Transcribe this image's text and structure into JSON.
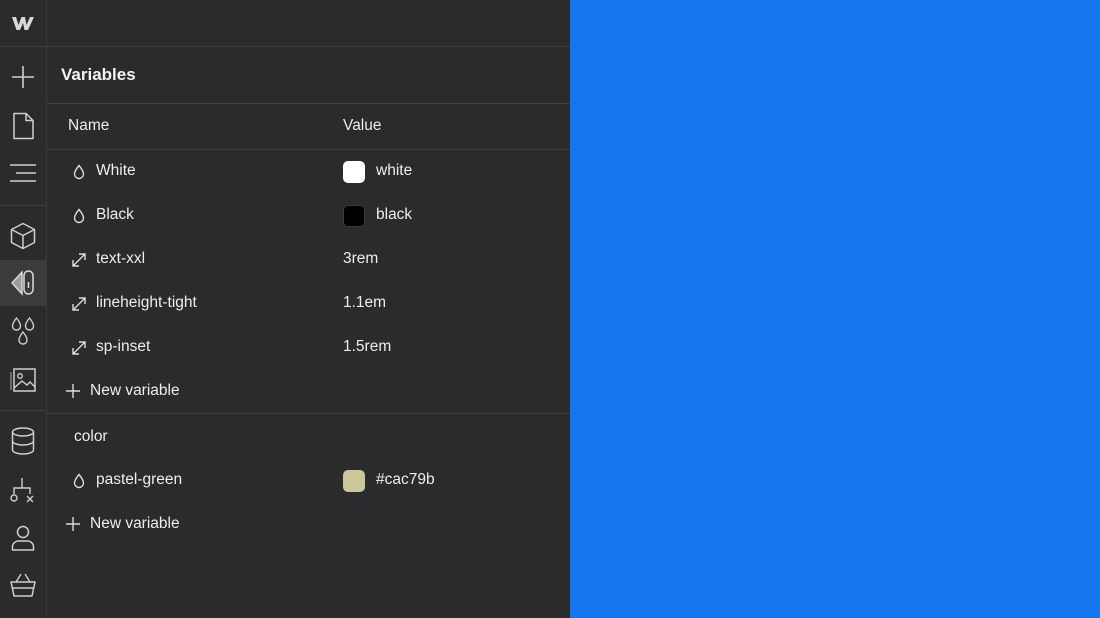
{
  "panel": {
    "title": "Variables",
    "columns": {
      "name": "Name",
      "value": "Value"
    },
    "variables": [
      {
        "icon": "droplet-icon",
        "name": "White",
        "value": "white",
        "swatch": "#ffffff"
      },
      {
        "icon": "droplet-icon",
        "name": "Black",
        "value": "black",
        "swatch": "#000000"
      },
      {
        "icon": "resize-arrow-icon",
        "name": "text-xxl",
        "value": "3rem"
      },
      {
        "icon": "resize-arrow-icon",
        "name": "lineheight-tight",
        "value": "1.1em"
      },
      {
        "icon": "resize-arrow-icon",
        "name": "sp-inset",
        "value": "1.5rem"
      }
    ],
    "new_variable_label": "New variable",
    "groups": [
      {
        "name": "color",
        "variables": [
          {
            "icon": "droplet-icon",
            "name": "pastel-green",
            "value": "#cac79b",
            "swatch": "#cac79b"
          }
        ],
        "new_variable_label": "New variable"
      }
    ]
  },
  "rail": {
    "items": [
      "webflow-logo-icon",
      "add-icon",
      "page-icon",
      "navigator-icon",
      "components-icon",
      "style-manager-icon",
      "variables-icon",
      "assets-icon",
      "cms-icon",
      "logic-icon",
      "users-icon",
      "ecommerce-icon"
    ],
    "active": "style-manager-icon"
  },
  "canvas": {
    "background": "#1476ef"
  }
}
